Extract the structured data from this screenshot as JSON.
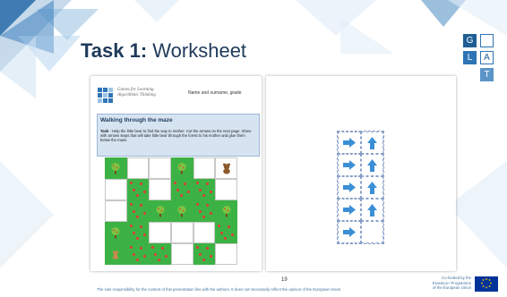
{
  "slide": {
    "title_bold": "Task 1:",
    "title_rest": " Worksheet",
    "logo_letters": [
      "G",
      "L",
      "A",
      "T"
    ],
    "page_number": "19",
    "disclaimer": "The sole responsibility for the content of this presentation lies with the authors. It does not necessarily reflect the opinion of the European Union.",
    "cofunded_lines": [
      "Co-funded by the",
      "Erasmus+ Programme",
      "of the European Union"
    ]
  },
  "worksheet": {
    "logo_text": "Games for Learning Algorithmic Thinking",
    "name_grade": "Name and surname, grade",
    "task_heading": "Walking through the maze",
    "task_label": "Task",
    "task_text": " - Help the little bear to find the way to mother. Cut the arrows on the next page. Show with arrows steps that will take little bear through the forest to his mother and glue them below the maze."
  },
  "colors": {
    "title": "#1f3a5a",
    "logo_blue": "#2e75b6",
    "maze_green": "#3db244",
    "arrow_blue": "#3b8fd6"
  },
  "maze": {
    "rows": 5,
    "cols": 6,
    "cells": [
      [
        "tree",
        "path",
        "path",
        "tree",
        "path",
        "bear"
      ],
      [
        "path",
        "grass",
        "path",
        "grass",
        "grass",
        "path"
      ],
      [
        "path",
        "grass",
        "tree",
        "tree",
        "grass",
        "tree"
      ],
      [
        "tree",
        "grass",
        "path",
        "path",
        "path",
        "grass"
      ],
      [
        "small-bear",
        "grass",
        "grass",
        "path",
        "grass",
        "path"
      ]
    ]
  },
  "arrows": [
    [
      "right",
      "up"
    ],
    [
      "right",
      "up"
    ],
    [
      "right",
      "up"
    ],
    [
      "right",
      "up"
    ],
    [
      "right",
      "empty"
    ]
  ]
}
